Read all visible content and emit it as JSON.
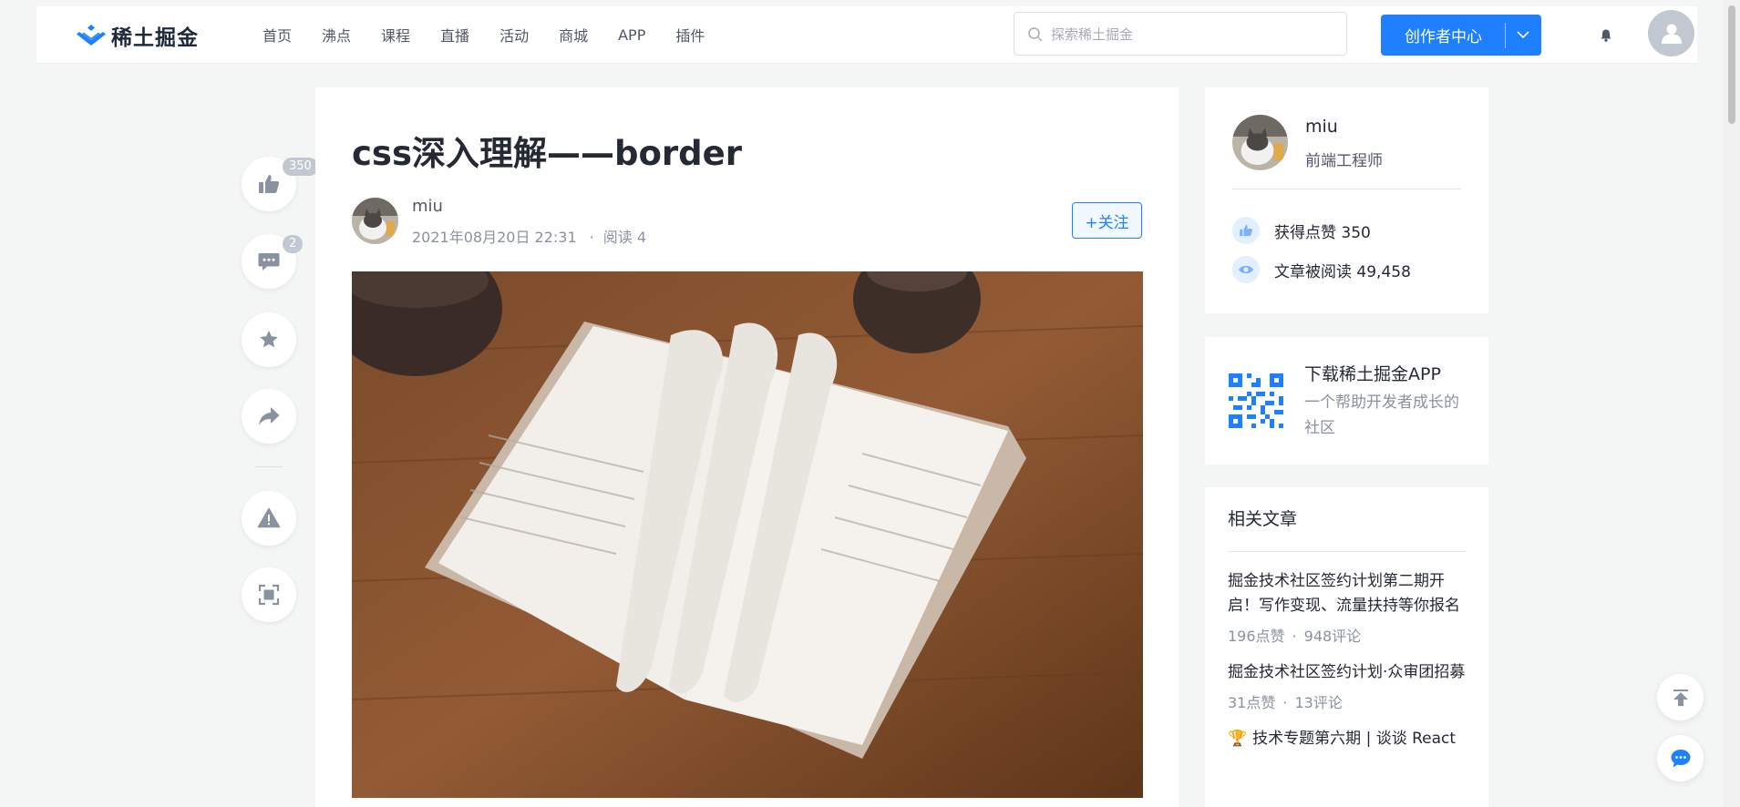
{
  "header": {
    "logo_text": "稀土掘金",
    "nav": [
      "首页",
      "沸点",
      "课程",
      "直播",
      "活动",
      "商城",
      "APP",
      "插件"
    ],
    "search_placeholder": "探索稀土掘金",
    "creator_label": "创作者中心"
  },
  "actions": {
    "like_count": "350",
    "comment_count": "2"
  },
  "article": {
    "title": "css深入理解——border",
    "author": "miu",
    "date": "2021年08月20日 22:31",
    "sep": "·",
    "reads": "阅读 4",
    "follow_label": "+关注"
  },
  "sidebar": {
    "author_name": "miu",
    "author_title": "前端工程师",
    "likes_text": "获得点赞 350",
    "reads_text": "文章被阅读 49,458",
    "app_title": "下载稀土掘金APP",
    "app_desc": "一个帮助开发者成长的社区",
    "related_heading": "相关文章",
    "related": [
      {
        "title": "掘金技术社区签约计划第二期开启！写作变现、流量扶持等你报名",
        "likes": "196点赞",
        "comments": "948评论"
      },
      {
        "title": "掘金技术社区签约计划·众审团招募",
        "likes": "31点赞",
        "comments": "13评论"
      },
      {
        "title": "技术专题第六期 | 谈谈 React",
        "likes": "",
        "comments": ""
      }
    ],
    "dot": "·"
  },
  "colors": {
    "accent": "#1e80ff",
    "page_bg": "#f4f5f5"
  },
  "icons": [
    "thumbs-up-icon",
    "comment-icon",
    "star-icon",
    "share-icon",
    "warning-icon",
    "fullscreen-icon",
    "search-icon",
    "bell-icon",
    "user-icon",
    "eye-icon",
    "qr-code-icon",
    "back-to-top-icon",
    "chat-icon"
  ]
}
